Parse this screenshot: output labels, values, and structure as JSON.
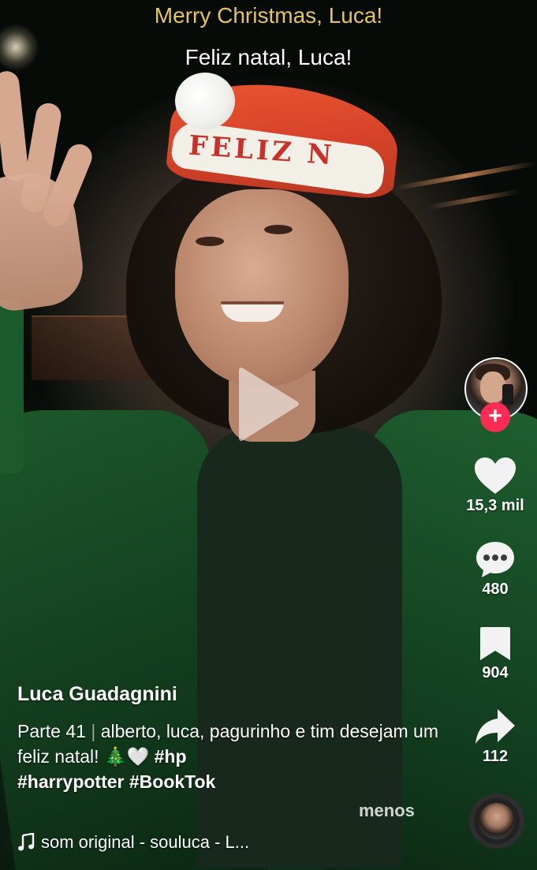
{
  "video": {
    "caption_top": "Merry Christmas, Luca!",
    "caption_sub": "Feliz natal, Luca!",
    "hat_text": "FELIZ N"
  },
  "actions": {
    "likes": "15,3 mil",
    "comments": "480",
    "saves": "904",
    "shares": "112",
    "follow_symbol": "+"
  },
  "post": {
    "username": "Luca Guadagnini",
    "part": "Parte 41",
    "separator": "|",
    "text": "alberto, luca, pagurinho e tim desejam um feliz natal! 🎄🤍",
    "tag_hp": "#hp",
    "tag_harrypotter": "#harrypotter",
    "tag_booktok": "#BookTok",
    "less_label": "menos",
    "sound_label": "som original - souluca - L..."
  },
  "colors": {
    "caption_gold": "#e4c560",
    "follow_red": "#fe2c55",
    "robe_green": "#1d5a2c"
  },
  "icons": {
    "like": "heart-icon",
    "comment": "comment-bubble-icon",
    "save": "bookmark-icon",
    "share": "share-arrow-icon",
    "play": "play-icon",
    "music": "music-note-icon"
  }
}
